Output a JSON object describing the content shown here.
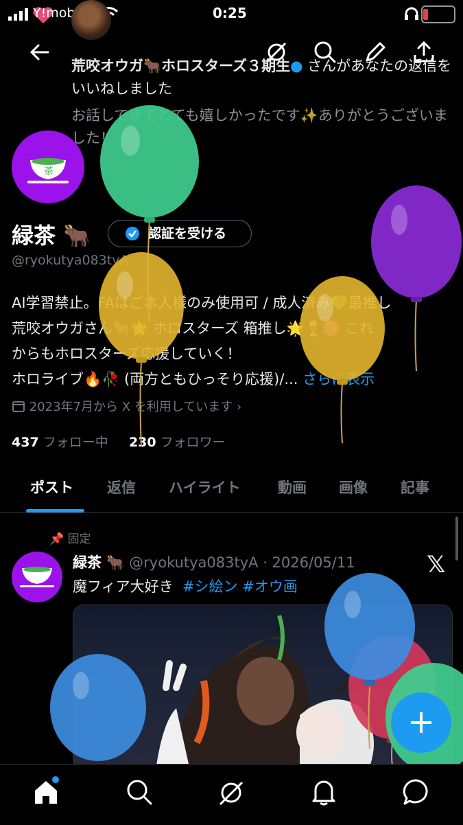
{
  "status": {
    "carrier": "Y!mobile",
    "time": "0:25"
  },
  "header": {
    "back_icon": "arrow-left-icon",
    "icons": [
      "grok-icon",
      "search-icon",
      "edit-icon",
      "share-icon"
    ]
  },
  "notification": {
    "line1": "荒咬オウガ🐂ホロスターズ３期生",
    "line1_rest": "さんがあなたの返信をいいねしました",
    "quote": "お話しできてとても嬉しかったです✨ありがとうございました！"
  },
  "profile": {
    "name": "緑茶",
    "name_emoji": "🐂",
    "verify_label": "認証を受ける",
    "handle": "@ryokutya083tyA",
    "bio_lines": [
      "AI学習禁止。FAはご本人様のみ使用可 / 成人済み💚最推し",
      "荒咬オウガさん🐂🌟 ホロスターズ 箱推し🌟🍷🟣 これ",
      "からもホロスターズ応援していく！",
      "ホロライブ🔥🥀 (両方ともひっそり応援)/..."
    ],
    "bio_more": "さらに表示",
    "joined": "2023年7月から X を利用しています",
    "following_count": "437",
    "following_label": "フォロー中",
    "followers_count": "230",
    "followers_label": "フォロワー"
  },
  "tabs": [
    "ポスト",
    "返信",
    "ハイライト",
    "動画",
    "画像",
    "記事"
  ],
  "active_tab": "ポスト",
  "post": {
    "pinned_label": "固定",
    "name": "緑茶 🐂",
    "handle_date": "@ryokutya083tyA · 2026/05/11",
    "text": "魔フィア大好き",
    "tags": [
      "#シ絵ン",
      "#オウ画"
    ]
  },
  "fab_label": "+",
  "bottom_nav": [
    "home-icon",
    "search-icon",
    "grok-icon",
    "notifications-icon",
    "messages-icon"
  ],
  "colors": {
    "accent": "#1d9bf0",
    "avatar_bg": "#9b12ea",
    "balloon_green": "#3fce8f",
    "balloon_yellow": "#e3b52d",
    "balloon_purple": "#8a2bd6",
    "balloon_blue": "#3d8ce0",
    "balloon_red": "#d2385a"
  }
}
